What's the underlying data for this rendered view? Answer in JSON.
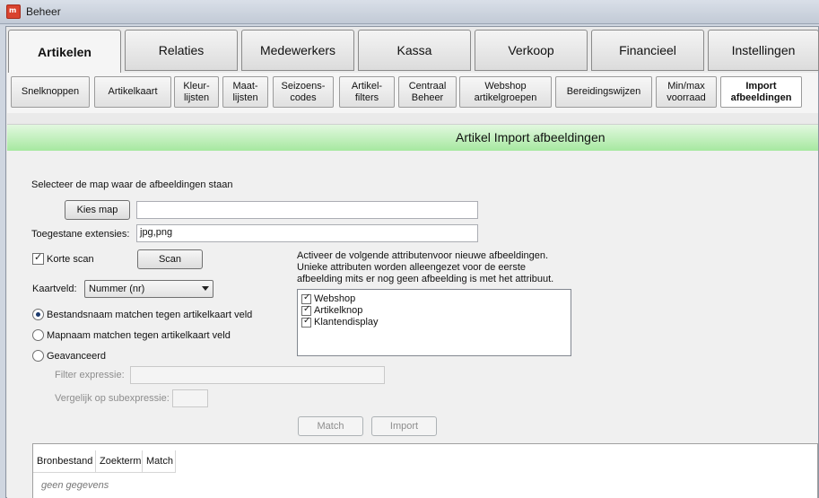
{
  "window": {
    "title": "Beheer",
    "app_icon_text": "m"
  },
  "top_tabs": [
    {
      "label": "Artikelen"
    },
    {
      "label": "Relaties"
    },
    {
      "label": "Medewerkers"
    },
    {
      "label": "Kassa"
    },
    {
      "label": "Verkoop"
    },
    {
      "label": "Financieel"
    },
    {
      "label": "Instellingen"
    }
  ],
  "sub_tabs": [
    {
      "label": "Snelknoppen"
    },
    {
      "label": "Artikelkaart"
    },
    {
      "label": "Kleur-\nlijsten"
    },
    {
      "label": "Maat-\nlijsten"
    },
    {
      "label": "Seizoens-\ncodes"
    },
    {
      "label": "Artikel-\nfilters"
    },
    {
      "label": "Centraal\nBeheer"
    },
    {
      "label": "Webshop\nartikelgroepen"
    },
    {
      "label": "Bereidingswijzen"
    },
    {
      "label": "Min/max\nvoorraad"
    },
    {
      "label": "Import\nafbeeldingen"
    }
  ],
  "header": {
    "title": "Artikel Import afbeeldingen"
  },
  "form": {
    "select_folder_label": "Selecteer de map waar de afbeeldingen staan",
    "choose_folder_button": "Kies map",
    "folder_value": "",
    "extensions_label": "Toegestane extensies:",
    "extensions_value": "jpg,png",
    "short_scan_label": "Korte scan",
    "short_scan_checked": true,
    "scan_button": "Scan",
    "card_field_label": "Kaartveld:",
    "card_field_value": "Nummer (nr)",
    "match_options": [
      {
        "label": "Bestandsnaam matchen tegen artikelkaart veld",
        "selected": true
      },
      {
        "label": "Mapnaam matchen tegen artikelkaart veld",
        "selected": false
      },
      {
        "label": "Geavanceerd",
        "selected": false
      }
    ],
    "filter_expression_label": "Filter expressie:",
    "filter_expression_value": "",
    "compare_subexpression_label": "Vergelijk op subexpressie:",
    "compare_subexpression_value": "",
    "attributes_info_line1": "Activeer de volgende attributenvoor nieuwe afbeeldingen.",
    "attributes_info_line2": "Unieke attributen worden alleengezet voor de eerste",
    "attributes_info_line3": "afbeelding mits er nog geen afbeelding is met het attribuut.",
    "attributes": [
      {
        "label": "Webshop",
        "checked": true
      },
      {
        "label": "Artikelknop",
        "checked": true
      },
      {
        "label": "Klantendisplay",
        "checked": true
      }
    ],
    "match_button": "Match",
    "import_button": "Import"
  },
  "grid": {
    "columns": [
      "Bronbestand",
      "Zoekterm",
      "Match"
    ],
    "empty_text": "geen gegevens"
  }
}
